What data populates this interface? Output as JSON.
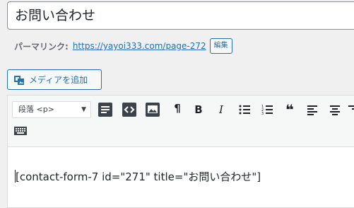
{
  "title": {
    "value": "お問い合わせ"
  },
  "permalink": {
    "label": "パーマリンク:",
    "url": "https://yayoi333.com/page-272",
    "edit_label": "編集"
  },
  "media_button": {
    "label": "メディアを追加",
    "icon": "media-add-icon"
  },
  "toolbar": {
    "format_select": {
      "value": "段落 <p>",
      "icon": "chevron-down-icon"
    },
    "buttons": [
      {
        "name": "read-more-icon"
      },
      {
        "name": "code-icon"
      },
      {
        "name": "image-icon"
      },
      {
        "name": "paragraph-icon",
        "glyph": "¶"
      },
      {
        "name": "bold-icon",
        "glyph": "B"
      },
      {
        "name": "italic-icon",
        "glyph": "I"
      },
      {
        "name": "bulleted-list-icon"
      },
      {
        "name": "numbered-list-icon"
      },
      {
        "name": "blockquote-icon",
        "glyph": "❝"
      },
      {
        "name": "align-left-icon"
      },
      {
        "name": "align-center-icon"
      },
      {
        "name": "align-right-icon"
      },
      {
        "name": "keyboard-icon"
      }
    ]
  },
  "editor": {
    "content": "[contact-form-7 id=\"271\" title=\"お問い合わせ\"]"
  },
  "colors": {
    "accent": "#2271b1",
    "background": "#f0f0f1",
    "text": "#1d2327"
  }
}
